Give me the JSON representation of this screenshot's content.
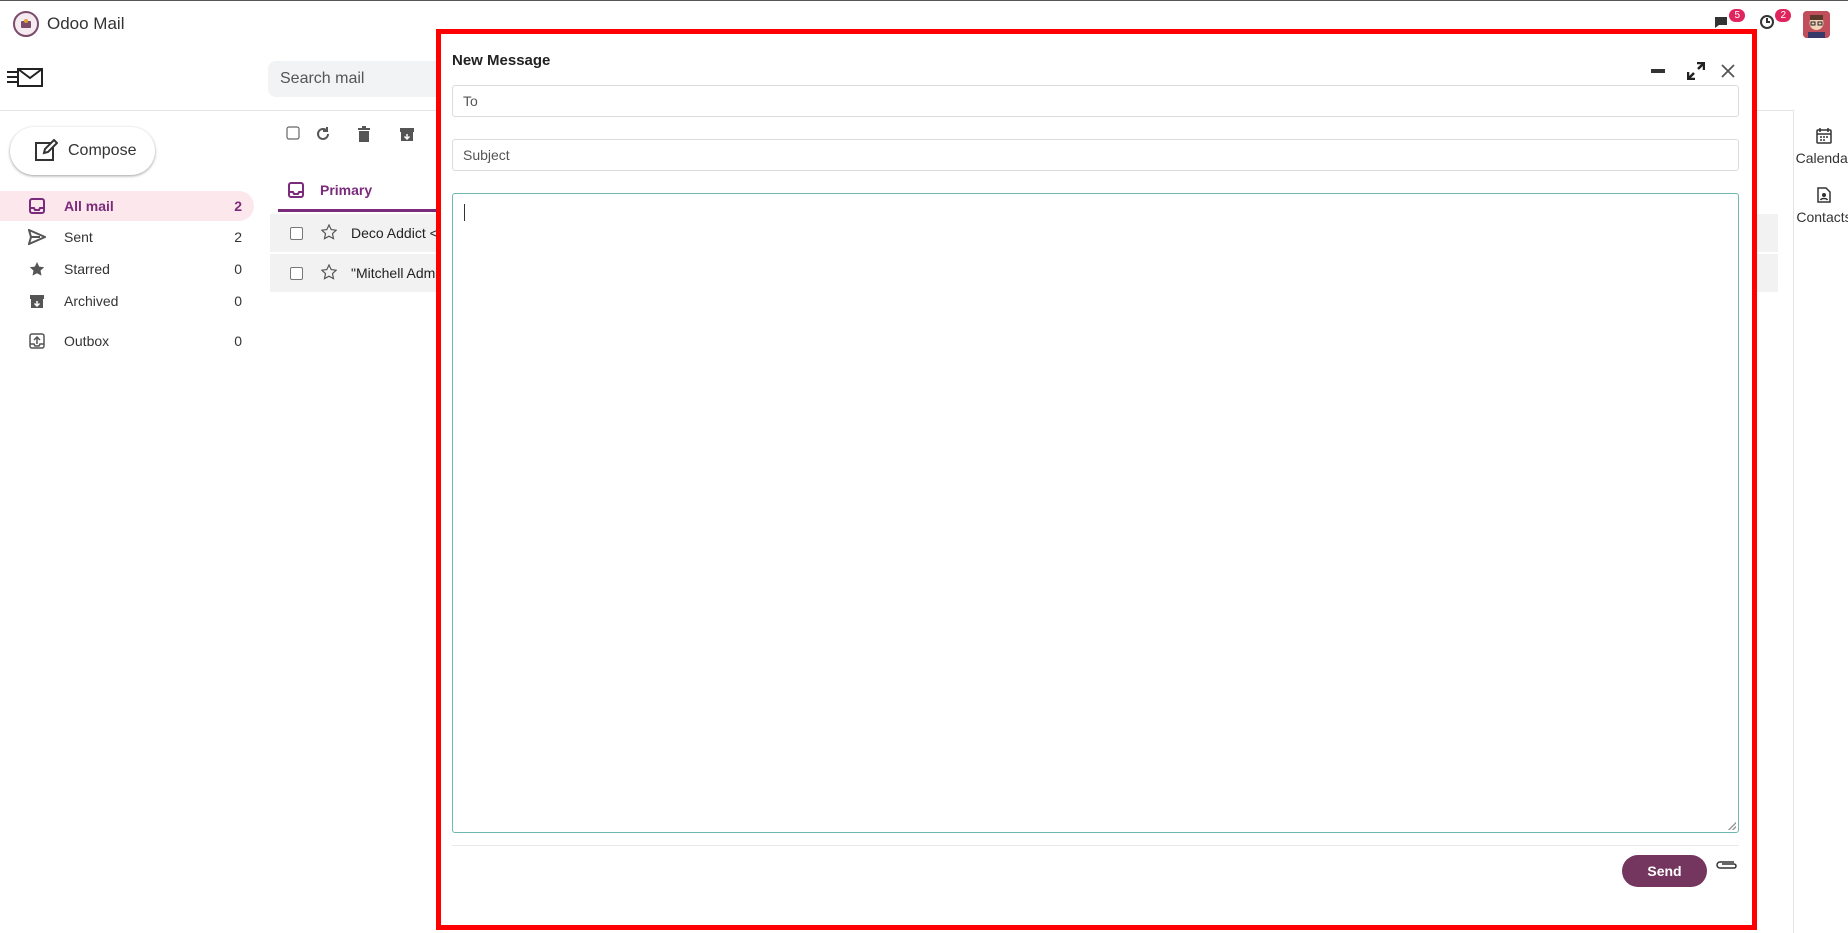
{
  "app": {
    "title": "Odoo Mail"
  },
  "topbar": {
    "messages_badge": "5",
    "activity_badge": "2"
  },
  "search": {
    "placeholder": "Search mail"
  },
  "sidebar": {
    "compose_label": "Compose",
    "items": [
      {
        "label": "All mail",
        "count": "2",
        "icon": "inbox-icon",
        "active": true
      },
      {
        "label": "Sent",
        "count": "2",
        "icon": "send-icon"
      },
      {
        "label": "Starred",
        "count": "0",
        "icon": "star-icon"
      },
      {
        "label": "Archived",
        "count": "0",
        "icon": "archive-icon"
      },
      {
        "label": "Outbox",
        "count": "0",
        "icon": "outbox-icon"
      }
    ]
  },
  "list": {
    "tab_primary": "Primary",
    "rows": [
      {
        "sender": "Deco Addict <"
      },
      {
        "sender": "\"Mitchell Adm"
      }
    ]
  },
  "right_panel": {
    "calendar_label": "Calendar",
    "contacts_label": "Contacts"
  },
  "compose_dialog": {
    "title": "New Message",
    "to_placeholder": "To",
    "subject_placeholder": "Subject",
    "body": "",
    "send_label": "Send"
  },
  "colors": {
    "accent": "#74365f",
    "active_bg": "#fce8ec",
    "highlight_border": "#ff0000"
  }
}
